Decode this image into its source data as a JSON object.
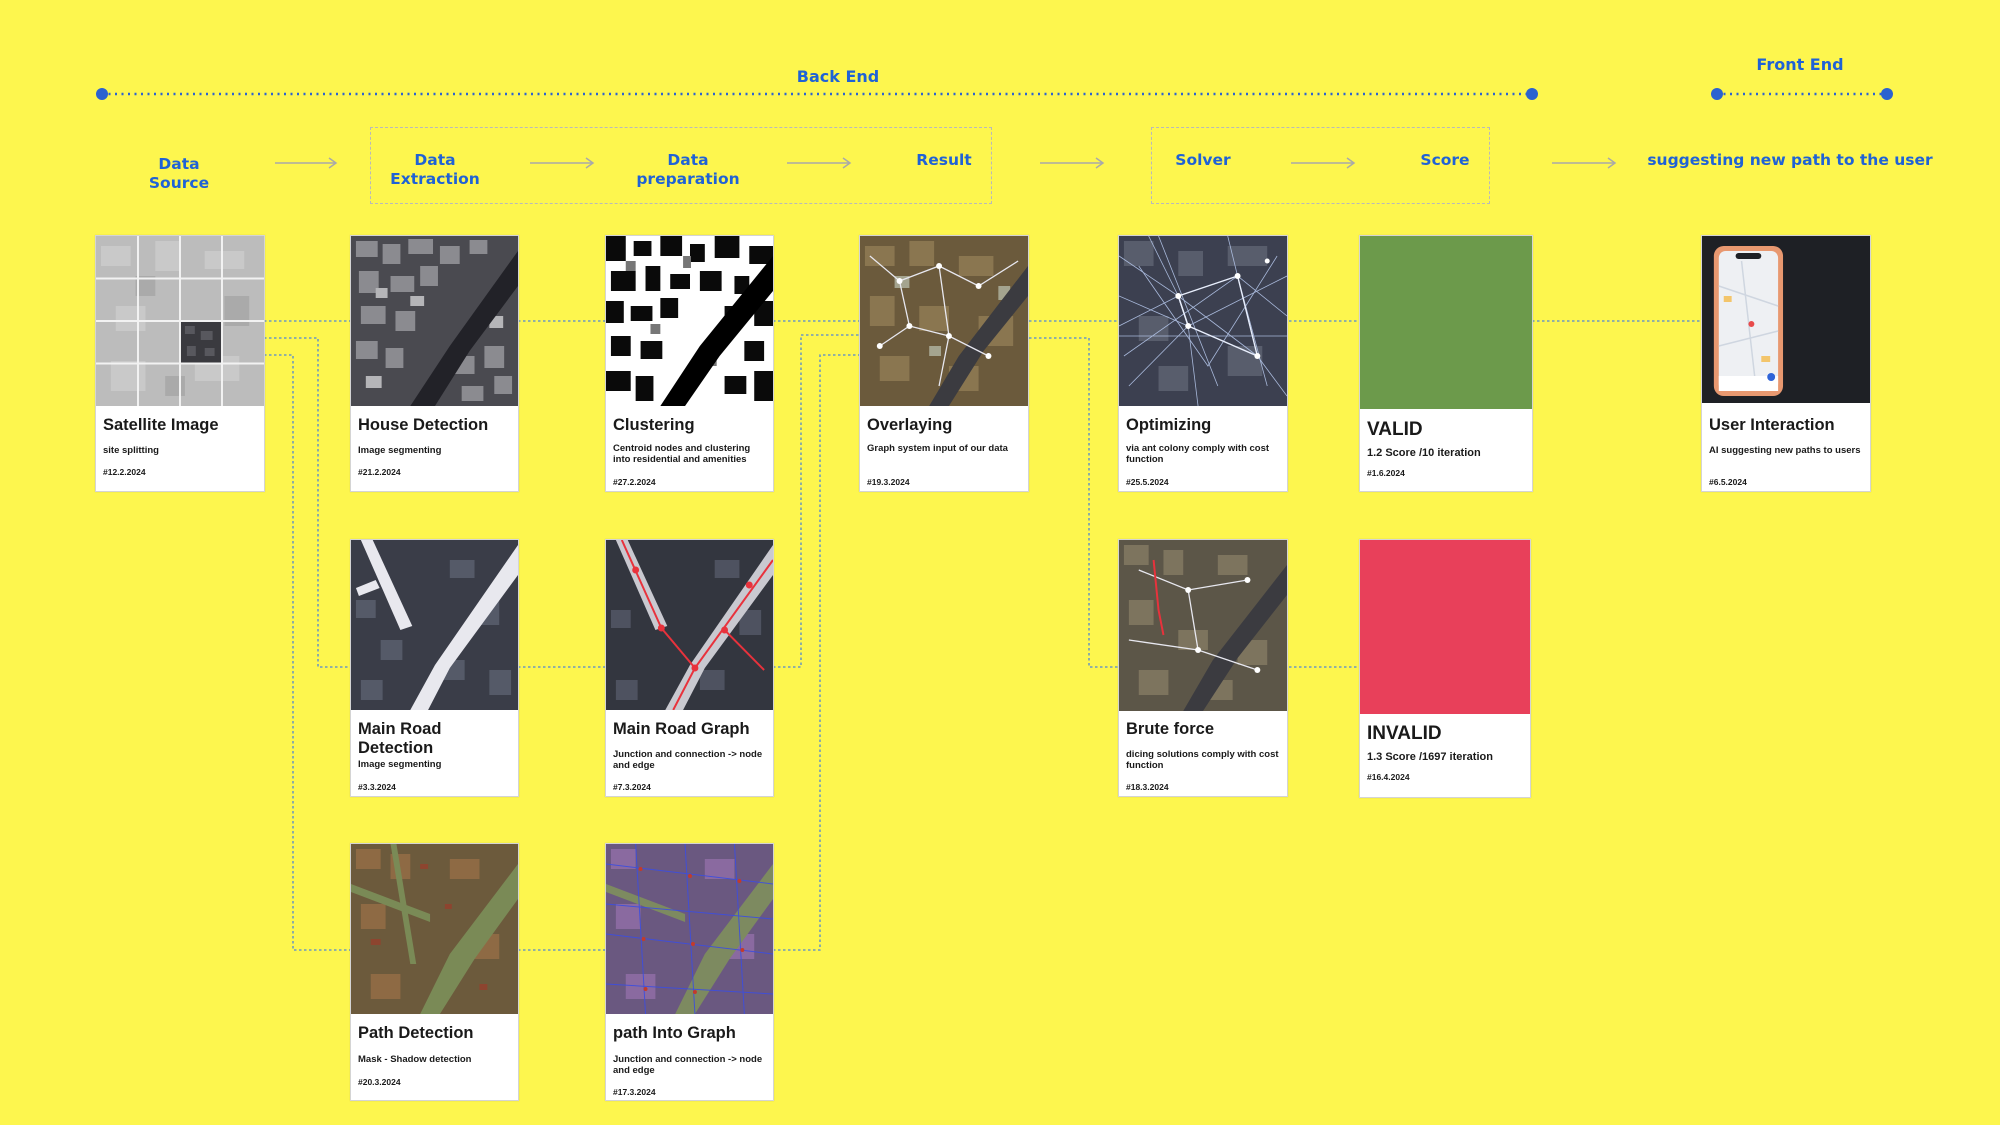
{
  "phases": {
    "backend": "Back End",
    "frontend": "Front End"
  },
  "stages": {
    "data_source": "Data\nSource",
    "data_extraction": "Data\nExtraction",
    "data_preparation": "Data\npreparation",
    "result": "Result",
    "solver": "Solver",
    "score": "Score",
    "suggest": "suggesting new path to the user"
  },
  "cards": {
    "satellite": {
      "title": "Satellite Image",
      "desc": "site splitting",
      "date": "#12.2.2024"
    },
    "house": {
      "title": "House Detection",
      "desc": "Image segmenting",
      "date": "#21.2.2024"
    },
    "clustering": {
      "title": "Clustering",
      "desc": "Centroid nodes and clustering into residential and amenities",
      "date": "#27.2.2024"
    },
    "overlaying": {
      "title": "Overlaying",
      "desc": "Graph system input of our data",
      "date": "#19.3.2024"
    },
    "optimizing": {
      "title": "Optimizing",
      "desc": "via ant colony comply with cost function",
      "date": "#25.5.2024"
    },
    "valid": {
      "title": "VALID",
      "desc": "1.2 Score /10 iteration",
      "date": "#1.6.2024"
    },
    "user": {
      "title": "User Interaction",
      "desc": "AI suggesting new paths to users",
      "date": "#6.5.2024"
    },
    "mainroad": {
      "title": "Main Road Detection",
      "desc": "Image segmenting",
      "date": "#3.3.2024"
    },
    "roadgraph": {
      "title": "Main Road Graph",
      "desc": "Junction and connection -> node and edge",
      "date": "#7.3.2024"
    },
    "brute": {
      "title": "Brute force",
      "desc": "dicing solutions comply with cost function",
      "date": "#18.3.2024"
    },
    "invalid": {
      "title": "INVALID",
      "desc": "1.3 Score /1697 iteration",
      "date": "#16.4.2024"
    },
    "path": {
      "title": "Path Detection",
      "desc": "Mask - Shadow detection",
      "date": "#20.3.2024"
    },
    "pathgraph": {
      "title": "path Into Graph",
      "desc": "Junction and connection -> node and edge",
      "date": "#17.3.2024"
    }
  },
  "colors": {
    "background": "#fdf64e",
    "accent_blue": "#1f62d6",
    "valid_green": "#6c9a4b",
    "invalid_red": "#e8405a",
    "connector": "#4f86d6"
  }
}
